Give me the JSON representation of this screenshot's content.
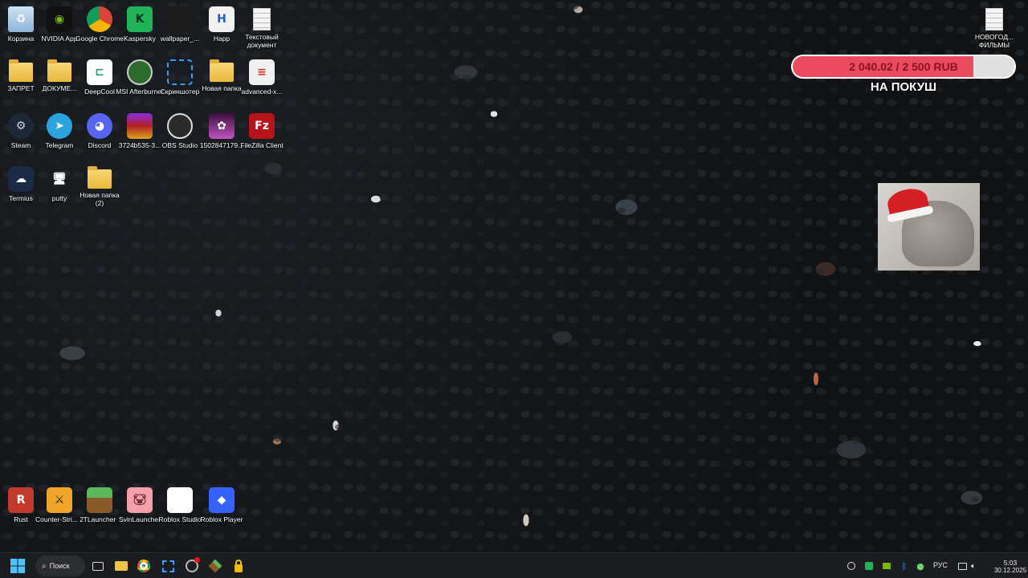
{
  "desktop_icons": [
    {
      "label": "Корзина",
      "icon": "recycle-bin-icon"
    },
    {
      "label": "NVIDIA App",
      "icon": "nvidia-icon"
    },
    {
      "label": "Google Chrome",
      "icon": "chrome-icon"
    },
    {
      "label": "Kaspersky",
      "icon": "kaspersky-icon"
    },
    {
      "label": "wallpaper_...",
      "icon": "wallpaper-icon"
    },
    {
      "label": "Happ",
      "icon": "happ-icon"
    },
    {
      "label": "Текстовый документ",
      "icon": "text-document-icon"
    },
    {
      "label": "ЗАПРЕТ",
      "icon": "folder-icon"
    },
    {
      "label": "ДОКУМЕ...",
      "icon": "folder-icon"
    },
    {
      "label": "DeepCool",
      "icon": "deepcool-icon"
    },
    {
      "label": "MSI Afterburner",
      "icon": "msi-afterburner-icon"
    },
    {
      "label": "Скриншотер",
      "icon": "screenshoter-icon"
    },
    {
      "label": "Новая папка",
      "icon": "folder-icon"
    },
    {
      "label": "advanced-x...",
      "icon": "advanced-document-icon"
    },
    {
      "label": "Steam",
      "icon": "steam-icon"
    },
    {
      "label": "Telegram",
      "icon": "telegram-icon"
    },
    {
      "label": "Discord",
      "icon": "discord-icon"
    },
    {
      "label": "3724b535-3...",
      "icon": "winrar-icon"
    },
    {
      "label": "OBS Studio",
      "icon": "obs-icon"
    },
    {
      "label": "1502847179...",
      "icon": "image-file-icon"
    },
    {
      "label": "FileZilla Client",
      "icon": "filezilla-icon"
    },
    {
      "label": "Termius",
      "icon": "termius-icon"
    },
    {
      "label": "putty",
      "icon": "putty-icon"
    },
    {
      "label": "Новая папка (2)",
      "icon": "folder-icon"
    },
    {
      "label": "Rust",
      "icon": "rust-icon"
    },
    {
      "label": "Counter-Stri... 2",
      "icon": "counter-strike-icon"
    },
    {
      "label": "TLauncher",
      "icon": "tlauncher-icon"
    },
    {
      "label": "SvinLauncher",
      "icon": "svinlauncher-icon"
    },
    {
      "label": "Roblox Studio",
      "icon": "roblox-studio-icon"
    },
    {
      "label": "Roblox Player",
      "icon": "roblox-player-icon"
    },
    {
      "label": "НОВОГОД... ФИЛЬМЫ",
      "icon": "text-document-icon"
    }
  ],
  "donation_goal": {
    "amount_text": "2 040.02 / 2 500 RUB",
    "progress_fraction": 0.816,
    "title": "НА ПОКУШ",
    "fill_color": "#ea4b5e"
  },
  "taskbar": {
    "search_label": "Поиск",
    "language": "РУС",
    "time": "5:03",
    "date": "30.12.2025",
    "pinned": [
      "start-icon",
      "task-view-icon",
      "file-explorer-icon",
      "chrome-icon",
      "screenshoter-icon",
      "msi-afterburner-icon",
      "minecraft-icon",
      "lock-icon"
    ]
  }
}
